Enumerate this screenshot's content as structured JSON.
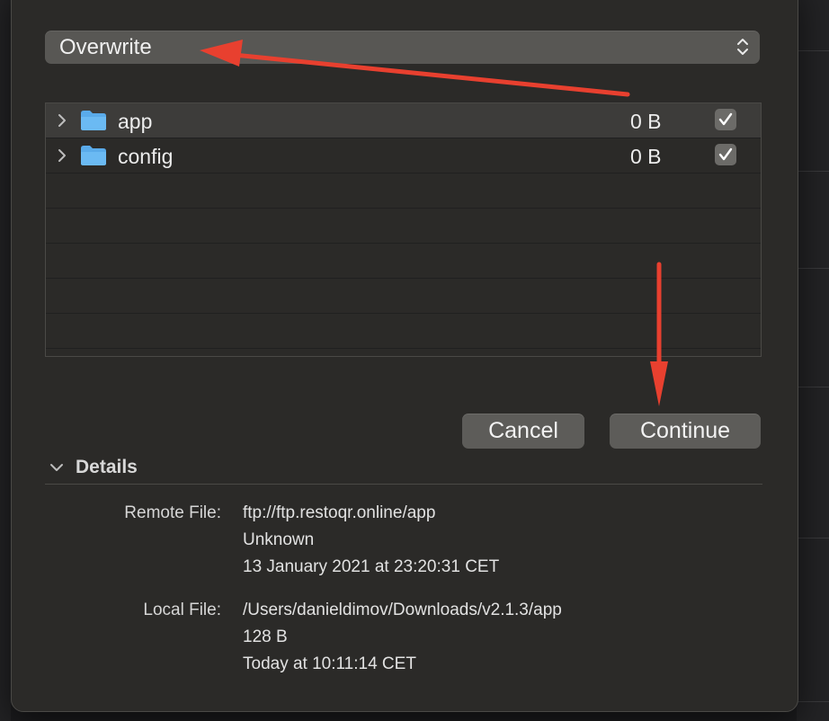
{
  "conflict": {
    "mode": "Overwrite"
  },
  "files": [
    {
      "name": "app",
      "size": "0 B",
      "checked": true
    },
    {
      "name": "config",
      "size": "0 B",
      "checked": true
    }
  ],
  "buttons": {
    "cancel": "Cancel",
    "continue": "Continue"
  },
  "details": {
    "toggle_label": "Details",
    "remote_label": "Remote File:",
    "remote_path": "ftp://ftp.restoqr.online/app",
    "remote_size": "Unknown",
    "remote_date": "13 January 2021 at 23:20:31 CET",
    "local_label": "Local File:",
    "local_path": "/Users/danieldimov/Downloads/v2.1.3/app",
    "local_size": "128 B",
    "local_date": "Today at 10:11:14 CET"
  },
  "colors": {
    "annotation_arrow": "#e8402f",
    "folder": "#5aabea"
  }
}
